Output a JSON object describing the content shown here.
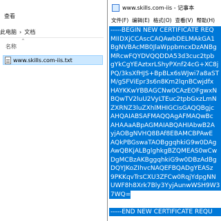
{
  "explorer": {
    "title": "查看",
    "breadcrumb": [
      "此电脑",
      "›",
      "文档"
    ],
    "column_header": "名称",
    "file": {
      "name": "www.skills.com-iis.txt",
      "icon": "text-file-icon"
    }
  },
  "notepad": {
    "title": "www.skills.com-iis - 记事本",
    "menu": [
      "文件(F)",
      "编辑(E)",
      "格式(O)",
      "查看(V)",
      "帮助(H)"
    ],
    "lines": [
      "-----BEGIN NEW CERTIFICATE REQ",
      "MIIDXjCCAscCAQAwbDELMAkGA1",
      "BgNVBAcMB0JlaWppbmcxDzANBg",
      "MRcwFQYDVQQDDA53d3cuc2tpb",
      "gYkCgYEAztxrLShyPXnf24cG+XC8j",
      "PQ/3ksXfHJS+BpBLx6sWJwi7a8aST",
      "M/gSFViEpr3s6n8Km2lqnBCwjdfx",
      "HAYKKwYBBAGCNw0CAzEOFgwxN",
      "BQwTV2luU2VyLTEuc2tpbGxzLmN",
      "ZXRNZ3luZXhlMHIGCisGAQQBgjc",
      "AHQAIABSAFMAQQAgAFMAQwBc",
      "AHAAaABpAGMAIABQAHIAbwB2A",
      "yjAOBgNVHQ8BAf8EBAMCBPAwE",
      "AQkPBGswaTAOBggqhkiG9w0DAg",
      "AwQBKjALBglghkgBZQMEAS0wCw",
      "DgMCBzAKBggqhkiG9w0DBzAdBg",
      "DQYJKoZIhvcNAQEFBQADgYEASz",
      "9PKKqvTrsCXU3ZFCw0RqjYdpgNN",
      "UWF8h8Xrk7Bly3YyjAunwWSH9W3",
      "7WQ=",
      "",
      "-----END NEW CERTIFICATE REQU"
    ]
  }
}
